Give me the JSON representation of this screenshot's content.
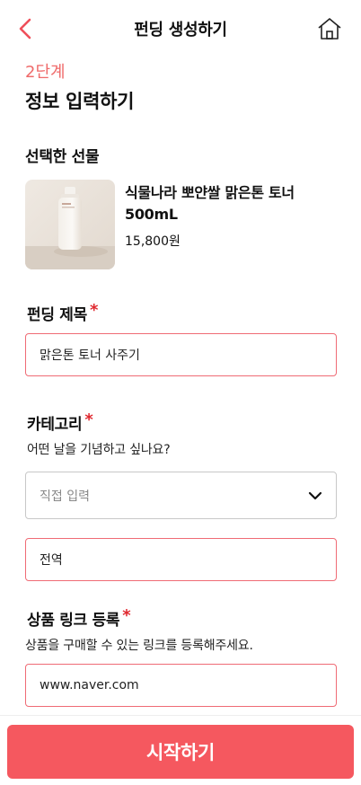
{
  "header": {
    "title": "펀딩 생성하기",
    "back_icon": "chevron-left-icon",
    "home_icon": "home-icon",
    "accent_color": "#ef4f5a"
  },
  "step": {
    "label": "2단계",
    "title": "정보 입력하기"
  },
  "gift": {
    "section_label": "선택한 선물",
    "product_name": "식물나라 뽀얀쌀 맑은톤 토너 500mL",
    "price": "15,800원"
  },
  "funding_title": {
    "label": "펀딩 제목",
    "required_mark": "*",
    "value": "맑은톤 토너 사주기"
  },
  "category": {
    "label": "카테고리",
    "required_mark": "*",
    "helper": "어떤 날을 기념하고 싶나요?",
    "select_value": "직접 입력",
    "custom_value": "전역"
  },
  "product_link": {
    "label": "상품 링크 등록",
    "required_mark": "*",
    "helper": "상품을 구매할 수 있는 링크를 등록해주세요.",
    "value": "www.naver.com"
  },
  "footer": {
    "start_label": "시작하기",
    "button_color": "#f5585f"
  }
}
